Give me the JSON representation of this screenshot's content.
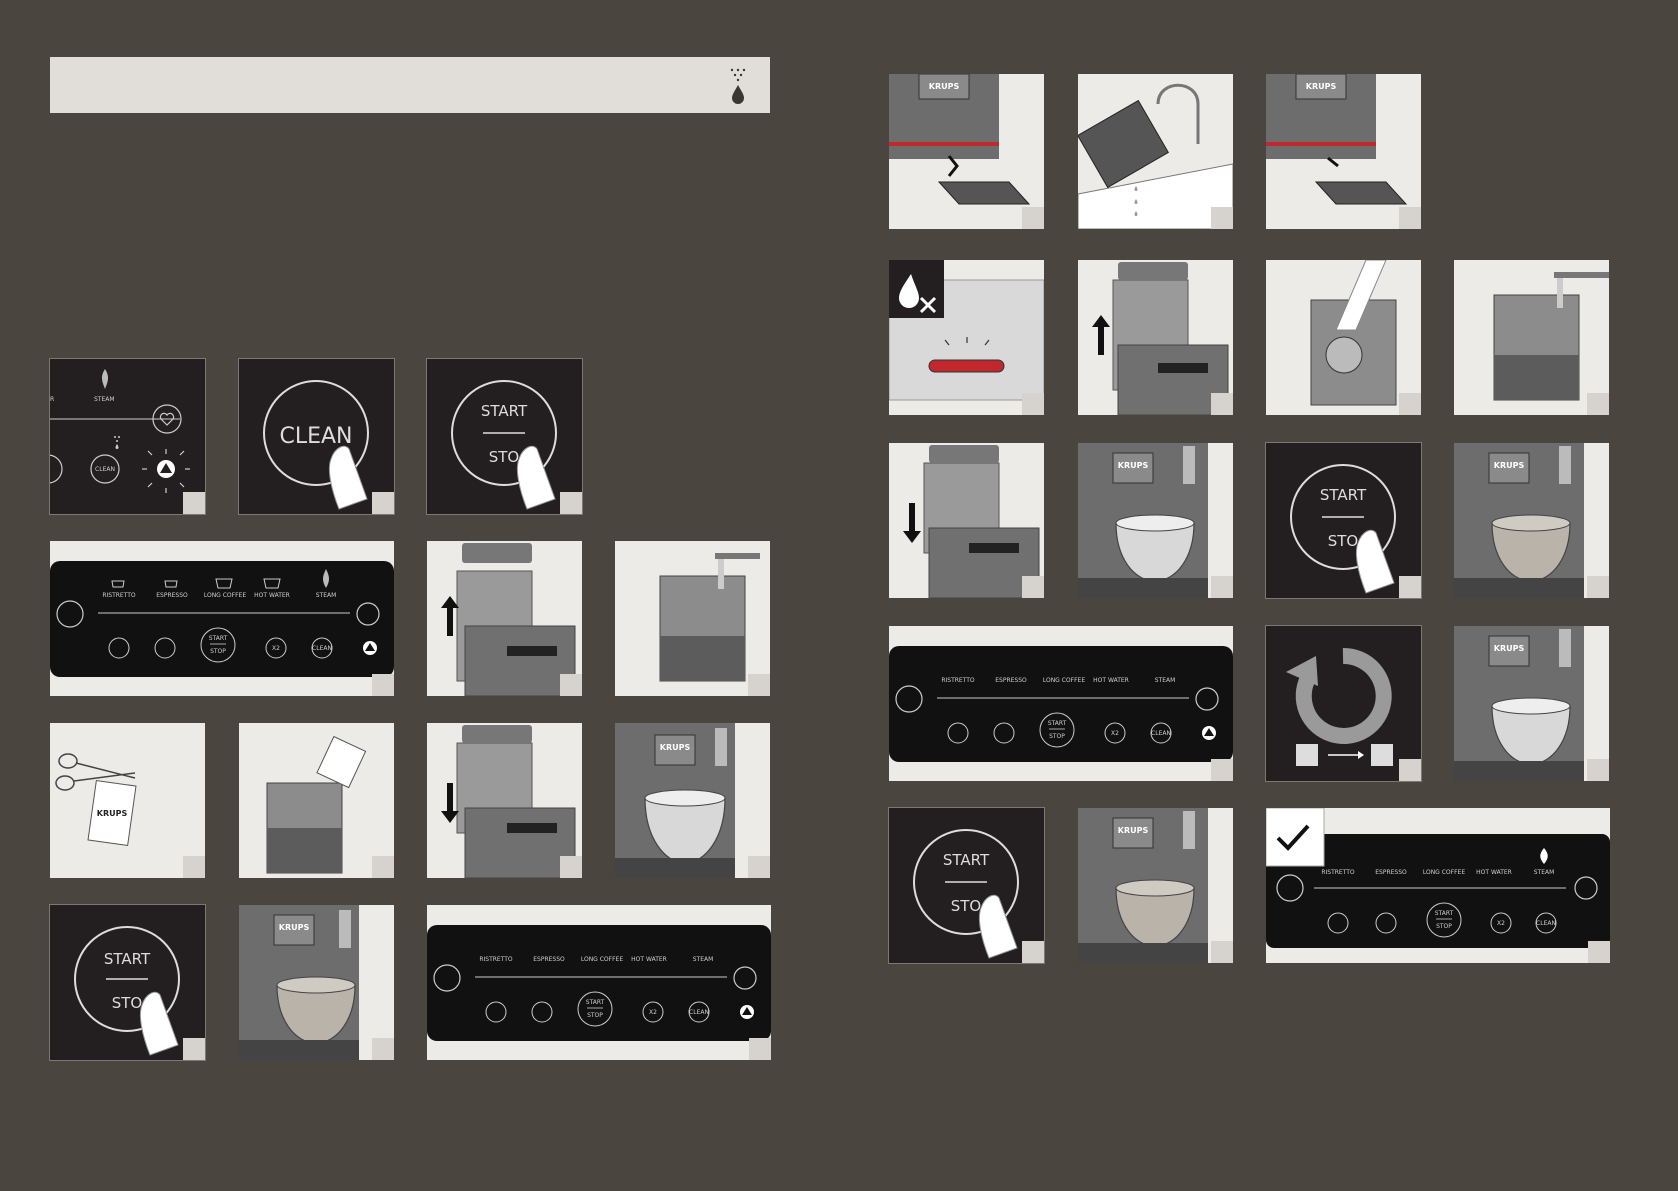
{
  "header": {
    "icon": "steam-drop-icon"
  },
  "brand": "KRUPS",
  "buttons": {
    "clean": "CLEAN",
    "start": "START",
    "stop": "STOP",
    "stop_partial": "STO",
    "x2": "X2"
  },
  "panel": {
    "drinks": [
      "RISTRETTO",
      "ESPRESSO",
      "LONG COFFEE",
      "HOT WATER",
      "STEAM"
    ],
    "x2": "X2",
    "clean": "CLEAN",
    "start": "START",
    "stop": "STOP"
  },
  "small_labels": {
    "steam": "STEAM",
    "clean": "CLEAN",
    "r": "R"
  },
  "colors": {
    "background": "#4a453f",
    "header": "#e1ded9",
    "tile_light": "#ecebe8",
    "tile_dark": "#231f20",
    "number_box": "#d6d3ce",
    "warning_red": "#c0282d"
  }
}
